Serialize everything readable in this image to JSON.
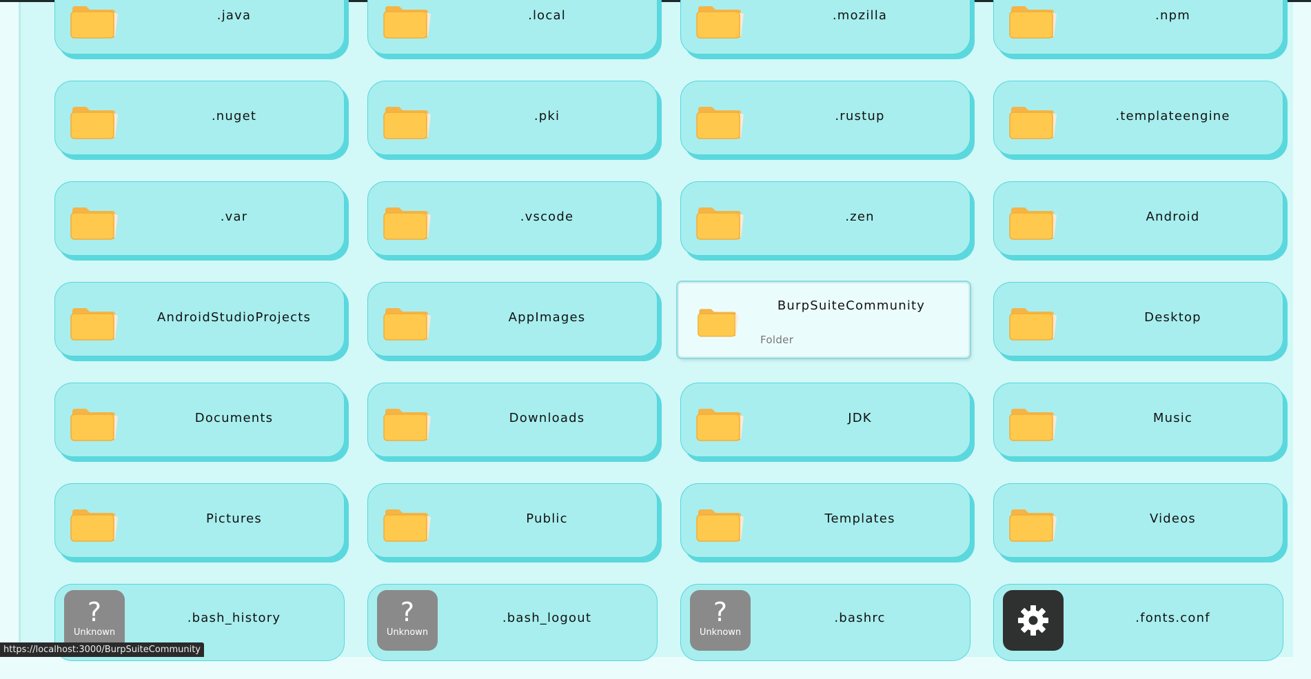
{
  "folders": [
    {
      "name": ".java"
    },
    {
      "name": ".local"
    },
    {
      "name": ".mozilla"
    },
    {
      "name": ".npm"
    },
    {
      "name": ".nuget"
    },
    {
      "name": ".pki"
    },
    {
      "name": ".rustup"
    },
    {
      "name": ".templateengine"
    },
    {
      "name": ".var"
    },
    {
      "name": ".vscode"
    },
    {
      "name": ".zen"
    },
    {
      "name": "Android"
    },
    {
      "name": "AndroidStudioProjects"
    },
    {
      "name": "AppImages"
    },
    {
      "name": "BurpSuiteCommunity",
      "kind": "Folder"
    },
    {
      "name": "Desktop"
    },
    {
      "name": "Documents"
    },
    {
      "name": "Downloads"
    },
    {
      "name": "JDK"
    },
    {
      "name": "Music"
    },
    {
      "name": "Pictures"
    },
    {
      "name": "Public"
    },
    {
      "name": "Templates"
    },
    {
      "name": "Videos"
    }
  ],
  "files": [
    {
      "name": ".bash_history",
      "badge": "?",
      "badge_label": "Unknown",
      "icon": "question-icon"
    },
    {
      "name": ".bash_logout",
      "badge": "?",
      "badge_label": "Unknown",
      "icon": "question-icon"
    },
    {
      "name": ".bashrc",
      "badge": "?",
      "badge_label": "Unknown",
      "icon": "question-icon"
    },
    {
      "name": ".fonts.conf",
      "icon": "gear-icon"
    }
  ],
  "status_url": "https://localhost:3000/BurpSuiteCommunity",
  "colors": {
    "card_bg": "#a8eeee",
    "card_shadow": "#5bd8de",
    "folder": "#ffc94d",
    "unknown_badge": "#8a8a8a",
    "config_badge": "#2f3030"
  }
}
